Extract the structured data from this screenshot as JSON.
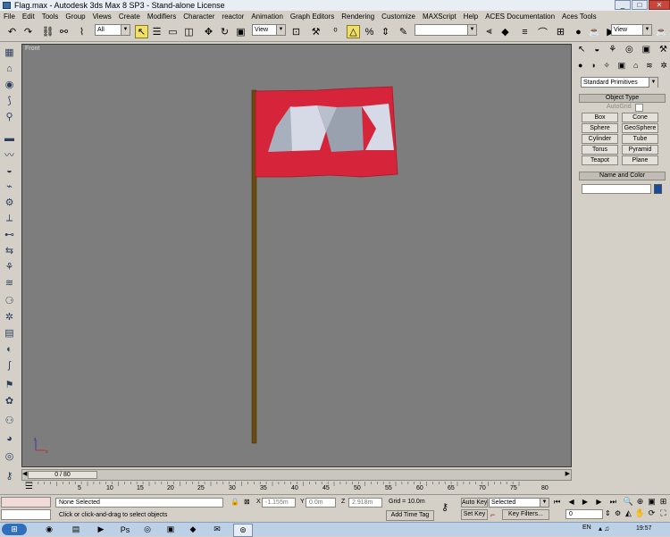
{
  "window": {
    "title": "Flag.max - Autodesk 3ds Max 8 SP3 - Stand-alone License"
  },
  "menu": [
    "File",
    "Edit",
    "Tools",
    "Group",
    "Views",
    "Create",
    "Modifiers",
    "Character",
    "reactor",
    "Animation",
    "Graph Editors",
    "Rendering",
    "Customize",
    "MAXScript",
    "Help",
    "ACES Documentation",
    "Aces Tools"
  ],
  "toolbar": {
    "selection_filter": "All",
    "reference_coord": "View",
    "named_selection": "",
    "render_view": "View"
  },
  "viewport": {
    "label": "Front",
    "background": "#7d7d7d",
    "flag_color": "#d6243a",
    "pole_color": "#6b4a10"
  },
  "timeline": {
    "slider_label": "0 / 80",
    "ticks": [
      "5",
      "10",
      "15",
      "20",
      "25",
      "30",
      "35",
      "40",
      "45",
      "50",
      "55",
      "60",
      "65",
      "70",
      "75",
      "80"
    ]
  },
  "command_panel": {
    "category": "Standard Primitives",
    "object_type_title": "Object Type",
    "autogrid_label": "AutoGrid",
    "buttons": [
      "Box",
      "Cone",
      "Sphere",
      "GeoSphere",
      "Cylinder",
      "Tube",
      "Torus",
      "Pyramid",
      "Teapot",
      "Plane"
    ],
    "name_color_title": "Name and Color",
    "name_value": "",
    "swatch_color": "#1a4aa0"
  },
  "status": {
    "selection": "None Selected",
    "prompt": "Click or click-and-drag to select objects",
    "x_label": "X",
    "x_value": "-1.155m",
    "y_label": "Y",
    "y_value": "0.0m",
    "z_label": "Z",
    "z_value": "2.918m",
    "grid": "Grid = 10.0m",
    "add_time_tag": "Add Time Tag",
    "auto_key": "Auto Key",
    "set_key": "Set Key",
    "key_mode": "Selected",
    "key_filters": "Key Filters...",
    "frame": "0"
  },
  "taskbar": {
    "language": "EN",
    "time": "19:57"
  }
}
